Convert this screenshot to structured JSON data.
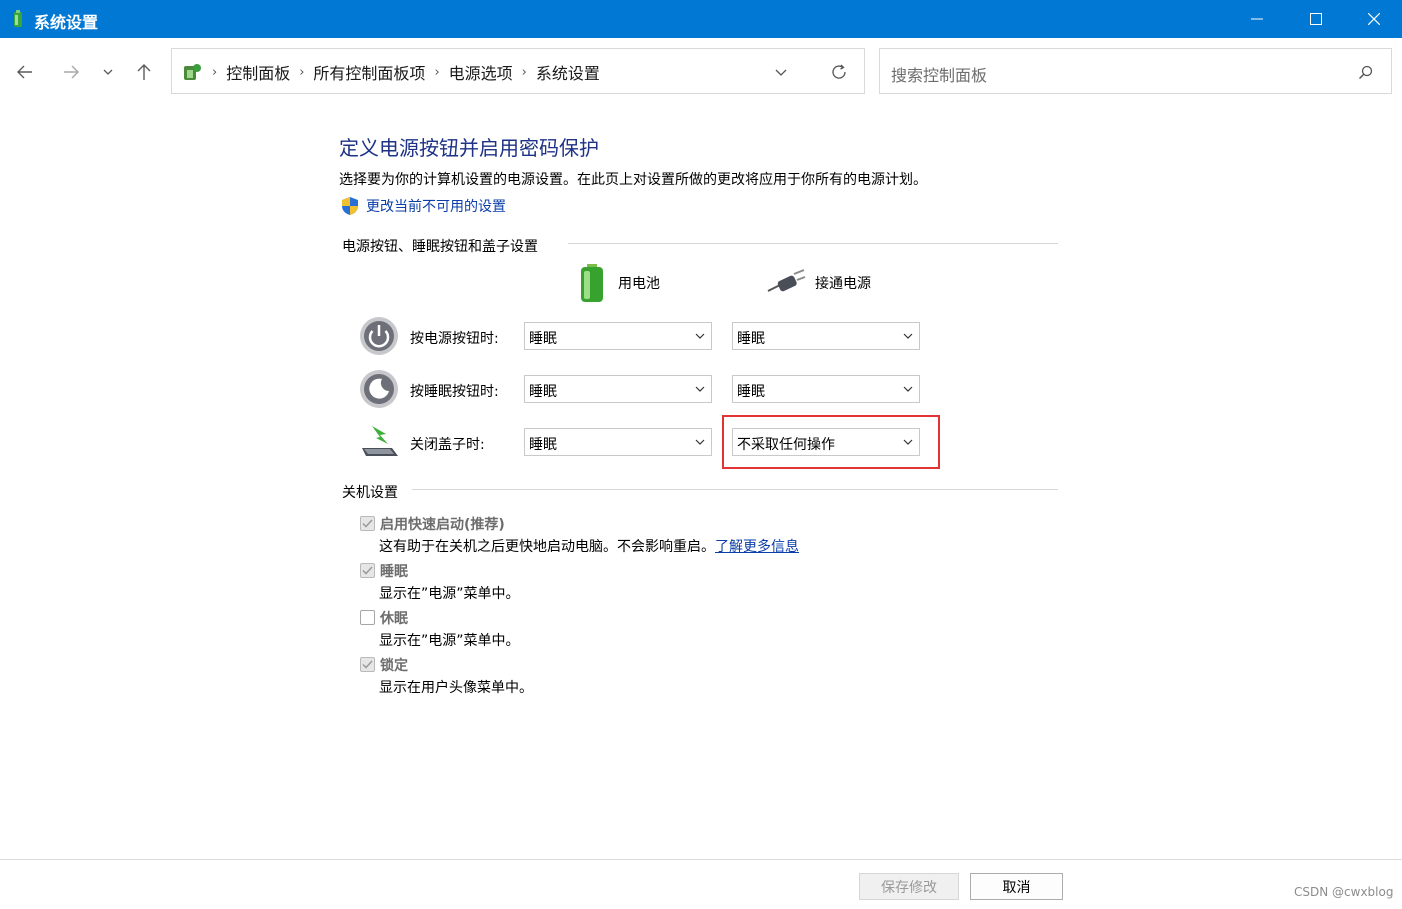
{
  "window": {
    "title": "系统设置",
    "minimize_icon": "minimize-icon",
    "maximize_icon": "maximize-icon",
    "close_icon": "close-icon"
  },
  "nav": {
    "back_icon": "arrow-left-icon",
    "forward_icon": "arrow-right-icon",
    "recent_icon": "chevron-down-icon",
    "up_icon": "arrow-up-icon"
  },
  "address": {
    "crumbs": [
      "控制面板",
      "所有控制面板项",
      "电源选项",
      "系统设置"
    ],
    "separator": "›"
  },
  "search": {
    "placeholder": "搜索控制面板"
  },
  "page": {
    "title": "定义电源按钮并启用密码保护",
    "description": "选择要为你的计算机设置的电源设置。在此页上对设置所做的更改将应用于你所有的电源计划。",
    "change_link": "更改当前不可用的设置"
  },
  "power_section": {
    "heading": "电源按钮、睡眠按钮和盖子设置",
    "col_battery": "用电池",
    "col_plugged": "接通电源",
    "rows": [
      {
        "label": "按电源按钮时:",
        "battery": "睡眠",
        "plugged": "睡眠"
      },
      {
        "label": "按睡眠按钮时:",
        "battery": "睡眠",
        "plugged": "睡眠"
      },
      {
        "label": "关闭盖子时:",
        "battery": "睡眠",
        "plugged": "不采取任何操作"
      }
    ]
  },
  "shutdown_section": {
    "heading": "关机设置",
    "items": [
      {
        "label": "启用快速启动(推荐)",
        "checked": true,
        "desc": "这有助于在关机之后更快地启动电脑。不会影响重启。",
        "link": "了解更多信息"
      },
      {
        "label": "睡眠",
        "checked": true,
        "desc": "显示在”电源”菜单中。"
      },
      {
        "label": "休眠",
        "checked": false,
        "desc": "显示在”电源”菜单中。"
      },
      {
        "label": "锁定",
        "checked": true,
        "desc": "显示在用户头像菜单中。"
      }
    ]
  },
  "footer": {
    "save": "保存修改",
    "cancel": "取消",
    "watermark": "CSDN @cwxblog"
  },
  "colors": {
    "titlebar": "#0078d4",
    "heading_blue": "#1e3287",
    "link_blue": "#0b3ea8",
    "highlight_red": "#e23434"
  }
}
